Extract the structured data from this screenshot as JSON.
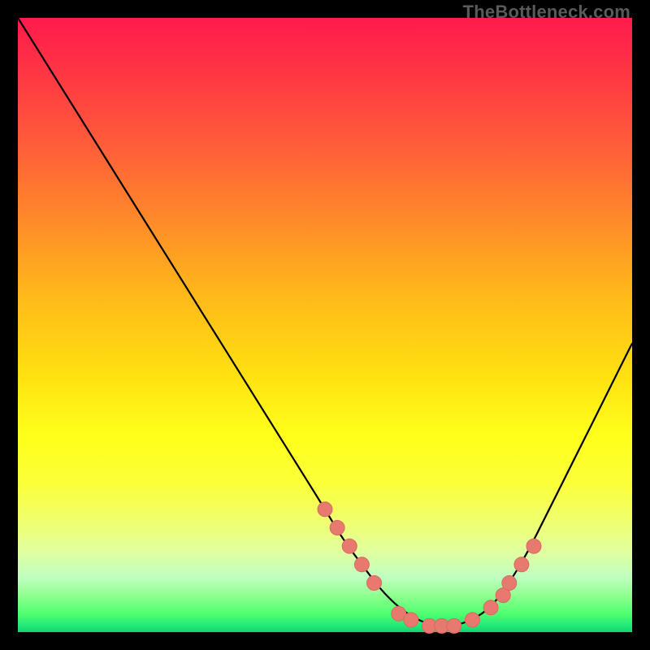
{
  "watermark": "TheBottleneck.com",
  "colors": {
    "curve": "#000000",
    "dot_fill": "#e8796e",
    "dot_stroke": "#d86a60",
    "background": "#000000"
  },
  "chart_data": {
    "type": "line",
    "title": "",
    "xlabel": "",
    "ylabel": "",
    "xlim": [
      0,
      100
    ],
    "ylim": [
      0,
      100
    ],
    "grid": false,
    "legend": false,
    "series": [
      {
        "name": "bottleneck-curve",
        "x": [
          0,
          5,
          10,
          15,
          20,
          25,
          30,
          35,
          40,
          45,
          50,
          53,
          56,
          59,
          62,
          65,
          68,
          71,
          74,
          77,
          80,
          83,
          86,
          89,
          92,
          95,
          98,
          100
        ],
        "y": [
          100,
          92,
          84,
          76,
          68,
          60,
          52,
          44,
          36,
          28,
          20,
          15,
          11,
          7,
          4,
          2,
          1,
          1,
          2,
          4,
          8,
          13,
          19,
          25,
          31,
          37,
          43,
          47
        ]
      }
    ],
    "dots": {
      "name": "highlight-dots",
      "x": [
        50,
        52,
        54,
        56,
        58,
        62,
        64,
        67,
        69,
        71,
        74,
        77,
        79,
        80,
        82,
        84
      ],
      "y": [
        20,
        17,
        14,
        11,
        8,
        3,
        2,
        1,
        1,
        1,
        2,
        4,
        6,
        8,
        11,
        14
      ]
    }
  }
}
